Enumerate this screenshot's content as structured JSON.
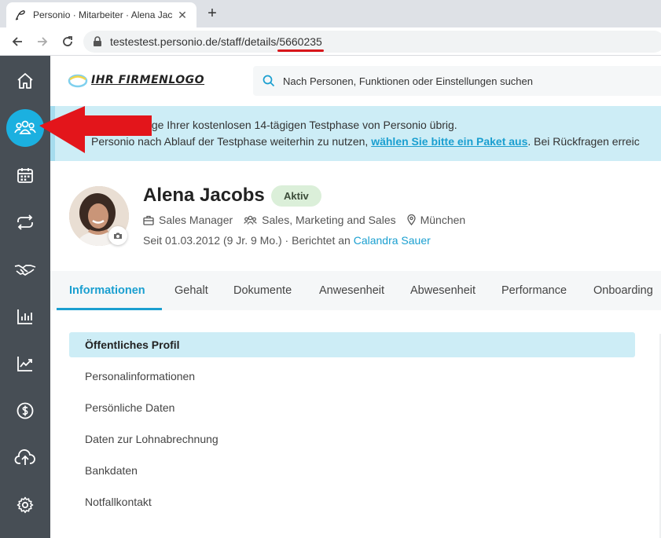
{
  "browser": {
    "tab_title": "Personio · Mitarbeiter · Alena Jac",
    "tab_close": "✕",
    "new_tab": "+",
    "url_base": "testestest.personio.de/staff/details/",
    "url_id": "5660235"
  },
  "header": {
    "logo_text": "IHR FIRMENLOGO",
    "search_placeholder": "Nach Personen, Funktionen oder Einstellungen suchen"
  },
  "banner": {
    "line1": "haben 60 Tage Ihrer kostenlosen 14-tägigen Testphase von Personio übrig.",
    "line2_prefix": "Personio nach Ablauf der Testphase weiterhin zu nutzen, ",
    "line2_link": "wählen Sie bitte ein Paket aus",
    "line2_suffix": ". Bei Rückfragen erreic"
  },
  "profile": {
    "name": "Alena Jacobs",
    "status": "Aktiv",
    "position": "Sales Manager",
    "department": "Sales, Marketing and Sales",
    "office": "München",
    "since": "Seit 01.03.2012 (9 Jr. 9 Mo.)",
    "separator": "·",
    "reports_to_label": "Berichtet an",
    "reports_to": "Calandra Sauer"
  },
  "tabs": [
    {
      "label": "Informationen"
    },
    {
      "label": "Gehalt"
    },
    {
      "label": "Dokumente"
    },
    {
      "label": "Anwesenheit"
    },
    {
      "label": "Abwesenheit"
    },
    {
      "label": "Performance"
    },
    {
      "label": "Onboarding"
    }
  ],
  "sections": [
    {
      "label": "Öffentliches Profil"
    },
    {
      "label": "Personalinformationen"
    },
    {
      "label": "Persönliche Daten"
    },
    {
      "label": "Daten zur Lohnabrechnung"
    },
    {
      "label": "Bankdaten"
    },
    {
      "label": "Notfallkontakt"
    }
  ],
  "sidebar_icons": [
    "home-icon",
    "people-icon",
    "calendar-icon",
    "sync-icon",
    "handshake-icon",
    "bar-chart-icon",
    "trending-icon",
    "dollar-icon",
    "cloud-upload-icon",
    "gear-icon"
  ],
  "colors": {
    "accent": "#1a9fd0",
    "sidebar": "#474e55",
    "sidebar_active": "#1bb0e0",
    "banner": "#cdedf6",
    "status_badge": "#dbefd9",
    "arrow": "#e3151b"
  }
}
